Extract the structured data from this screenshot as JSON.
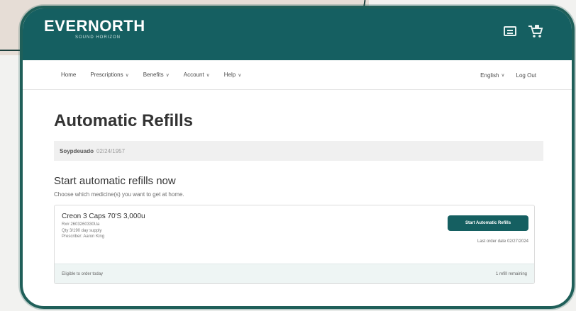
{
  "header": {
    "logo": "EVERNORTH",
    "logo_sub": "SOUND HORIZON",
    "icons": [
      "message-icon",
      "cart-icon"
    ]
  },
  "nav": {
    "items": [
      {
        "label": "Home",
        "has_menu": false
      },
      {
        "label": "Prescriptions",
        "has_menu": true
      },
      {
        "label": "Benefits",
        "has_menu": true
      },
      {
        "label": "Account",
        "has_menu": true
      },
      {
        "label": "Help",
        "has_menu": true
      }
    ],
    "language": "English",
    "logout": "Log Out",
    "chevron": "∨"
  },
  "page": {
    "title": "Automatic Refills",
    "member_name": "Soypdeuado",
    "member_id": "02/24/1957"
  },
  "section": {
    "title": "Start automatic refills now",
    "subtitle": "Choose which medicine(s) you want to get at home."
  },
  "card": {
    "drug_name": "Creon 3 Caps 70'S 3,000u",
    "rx": "Rx# 2603260330Ua",
    "qty": "Qty 3/190 day supply",
    "prescriber": "Prescriber: Aaron King",
    "button": "Start Automatic Refills",
    "last_order": "Last order date 02/27/2024",
    "footer_left": "Eligible to order today",
    "footer_right": "1 refill remaining"
  },
  "colors": {
    "brand_teal": "#155f61",
    "frame": "#1f5f59"
  }
}
